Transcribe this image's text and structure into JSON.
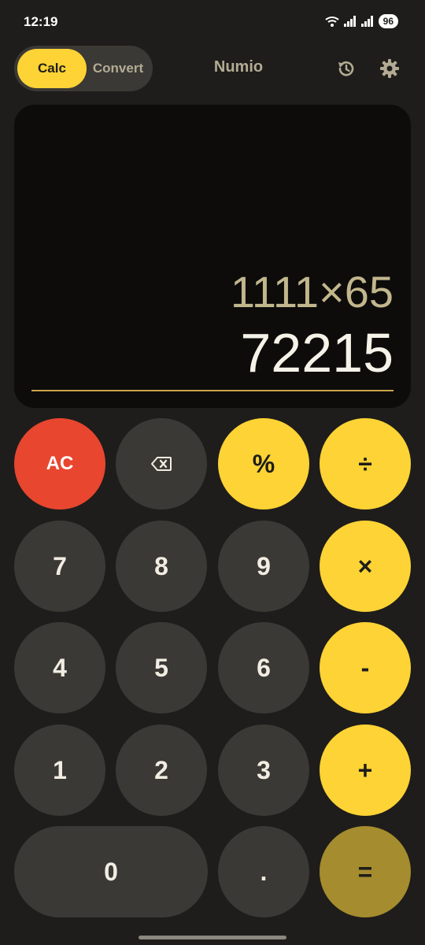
{
  "status_bar": {
    "time": "12:19",
    "battery": "96"
  },
  "top_bar": {
    "mode_calc": "Calc",
    "mode_convert": "Convert",
    "title": "Numio",
    "history_icon": "history-icon",
    "settings_icon": "gear-icon"
  },
  "display": {
    "expression": "1111×65",
    "result": "72215"
  },
  "keys": {
    "ac": "AC",
    "backspace_icon": "backspace-icon",
    "percent": "%",
    "divide": "÷",
    "seven": "7",
    "eight": "8",
    "nine": "9",
    "multiply": "×",
    "four": "4",
    "five": "5",
    "six": "6",
    "minus": "-",
    "one": "1",
    "two": "2",
    "three": "3",
    "plus": "+",
    "zero": "0",
    "decimal": ".",
    "equals": "="
  },
  "colors": {
    "background": "#1e1d1b",
    "accent_yellow": "#fdd335",
    "clear_red": "#e8462f",
    "equals_olive": "#a58c2e",
    "key_dark": "#3b3935"
  }
}
